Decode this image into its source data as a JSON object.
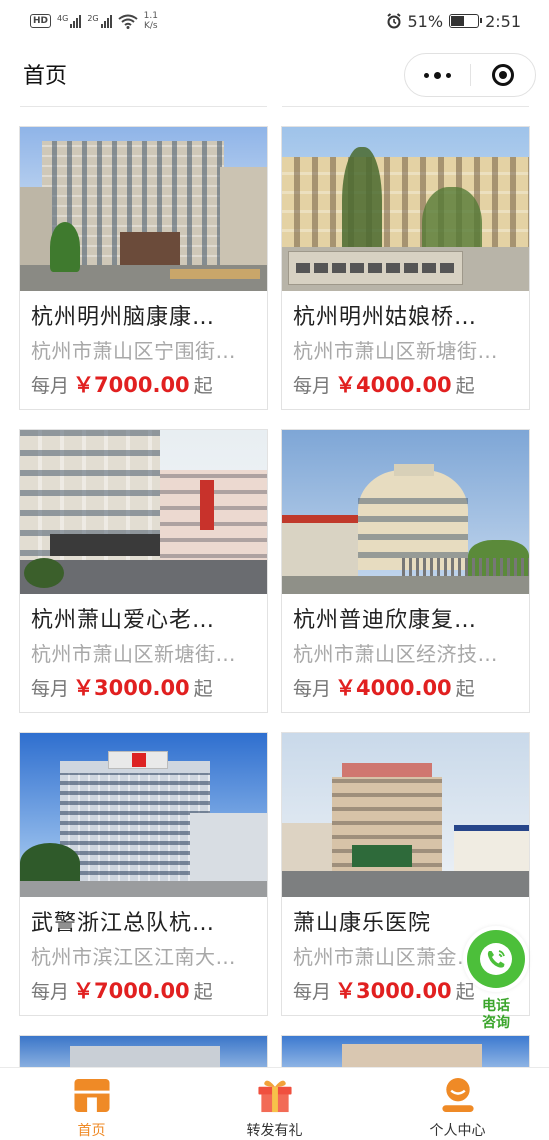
{
  "status_bar": {
    "network_left": "HD",
    "sim1": "4G",
    "sim2": "2G",
    "speed_value": "1.1",
    "speed_unit": "K/s",
    "battery_percent": "51%",
    "time": "2:51",
    "battery_level": 0.51
  },
  "nav": {
    "title": "首页"
  },
  "cards": [
    {
      "name": "杭州明州脑康康…",
      "address": "杭州市萧山区宁围街…",
      "price_prefix": "每月",
      "price": "￥7000.00",
      "price_suffix": "起"
    },
    {
      "name": "杭州明州姑娘桥…",
      "address": "杭州市萧山区新塘街…",
      "price_prefix": "每月",
      "price": "￥4000.00",
      "price_suffix": "起"
    },
    {
      "name": "杭州萧山爱心老…",
      "address": "杭州市萧山区新塘街…",
      "price_prefix": "每月",
      "price": "￥3000.00",
      "price_suffix": "起"
    },
    {
      "name": "杭州普迪欣康复…",
      "address": "杭州市萧山区经济技…",
      "price_prefix": "每月",
      "price": "￥4000.00",
      "price_suffix": "起"
    },
    {
      "name": "武警浙江总队杭…",
      "address": "杭州市滨江区江南大…",
      "price_prefix": "每月",
      "price": "￥7000.00",
      "price_suffix": "起"
    },
    {
      "name": "萧山康乐医院",
      "address": "杭州市萧山区萧金…",
      "price_prefix": "每月",
      "price": "￥3000.00",
      "price_suffix": "起"
    }
  ],
  "float_call": {
    "label_line1": "电话",
    "label_line2": "咨询"
  },
  "tabs": [
    {
      "label": "首页",
      "icon": "home-icon",
      "active": true
    },
    {
      "label": "转发有礼",
      "icon": "gift-icon",
      "active": false
    },
    {
      "label": "个人中心",
      "icon": "user-icon",
      "active": false
    }
  ],
  "colors": {
    "price": "#e12020",
    "tab_active": "#ef8a26",
    "call_button": "#4cbf3a"
  }
}
